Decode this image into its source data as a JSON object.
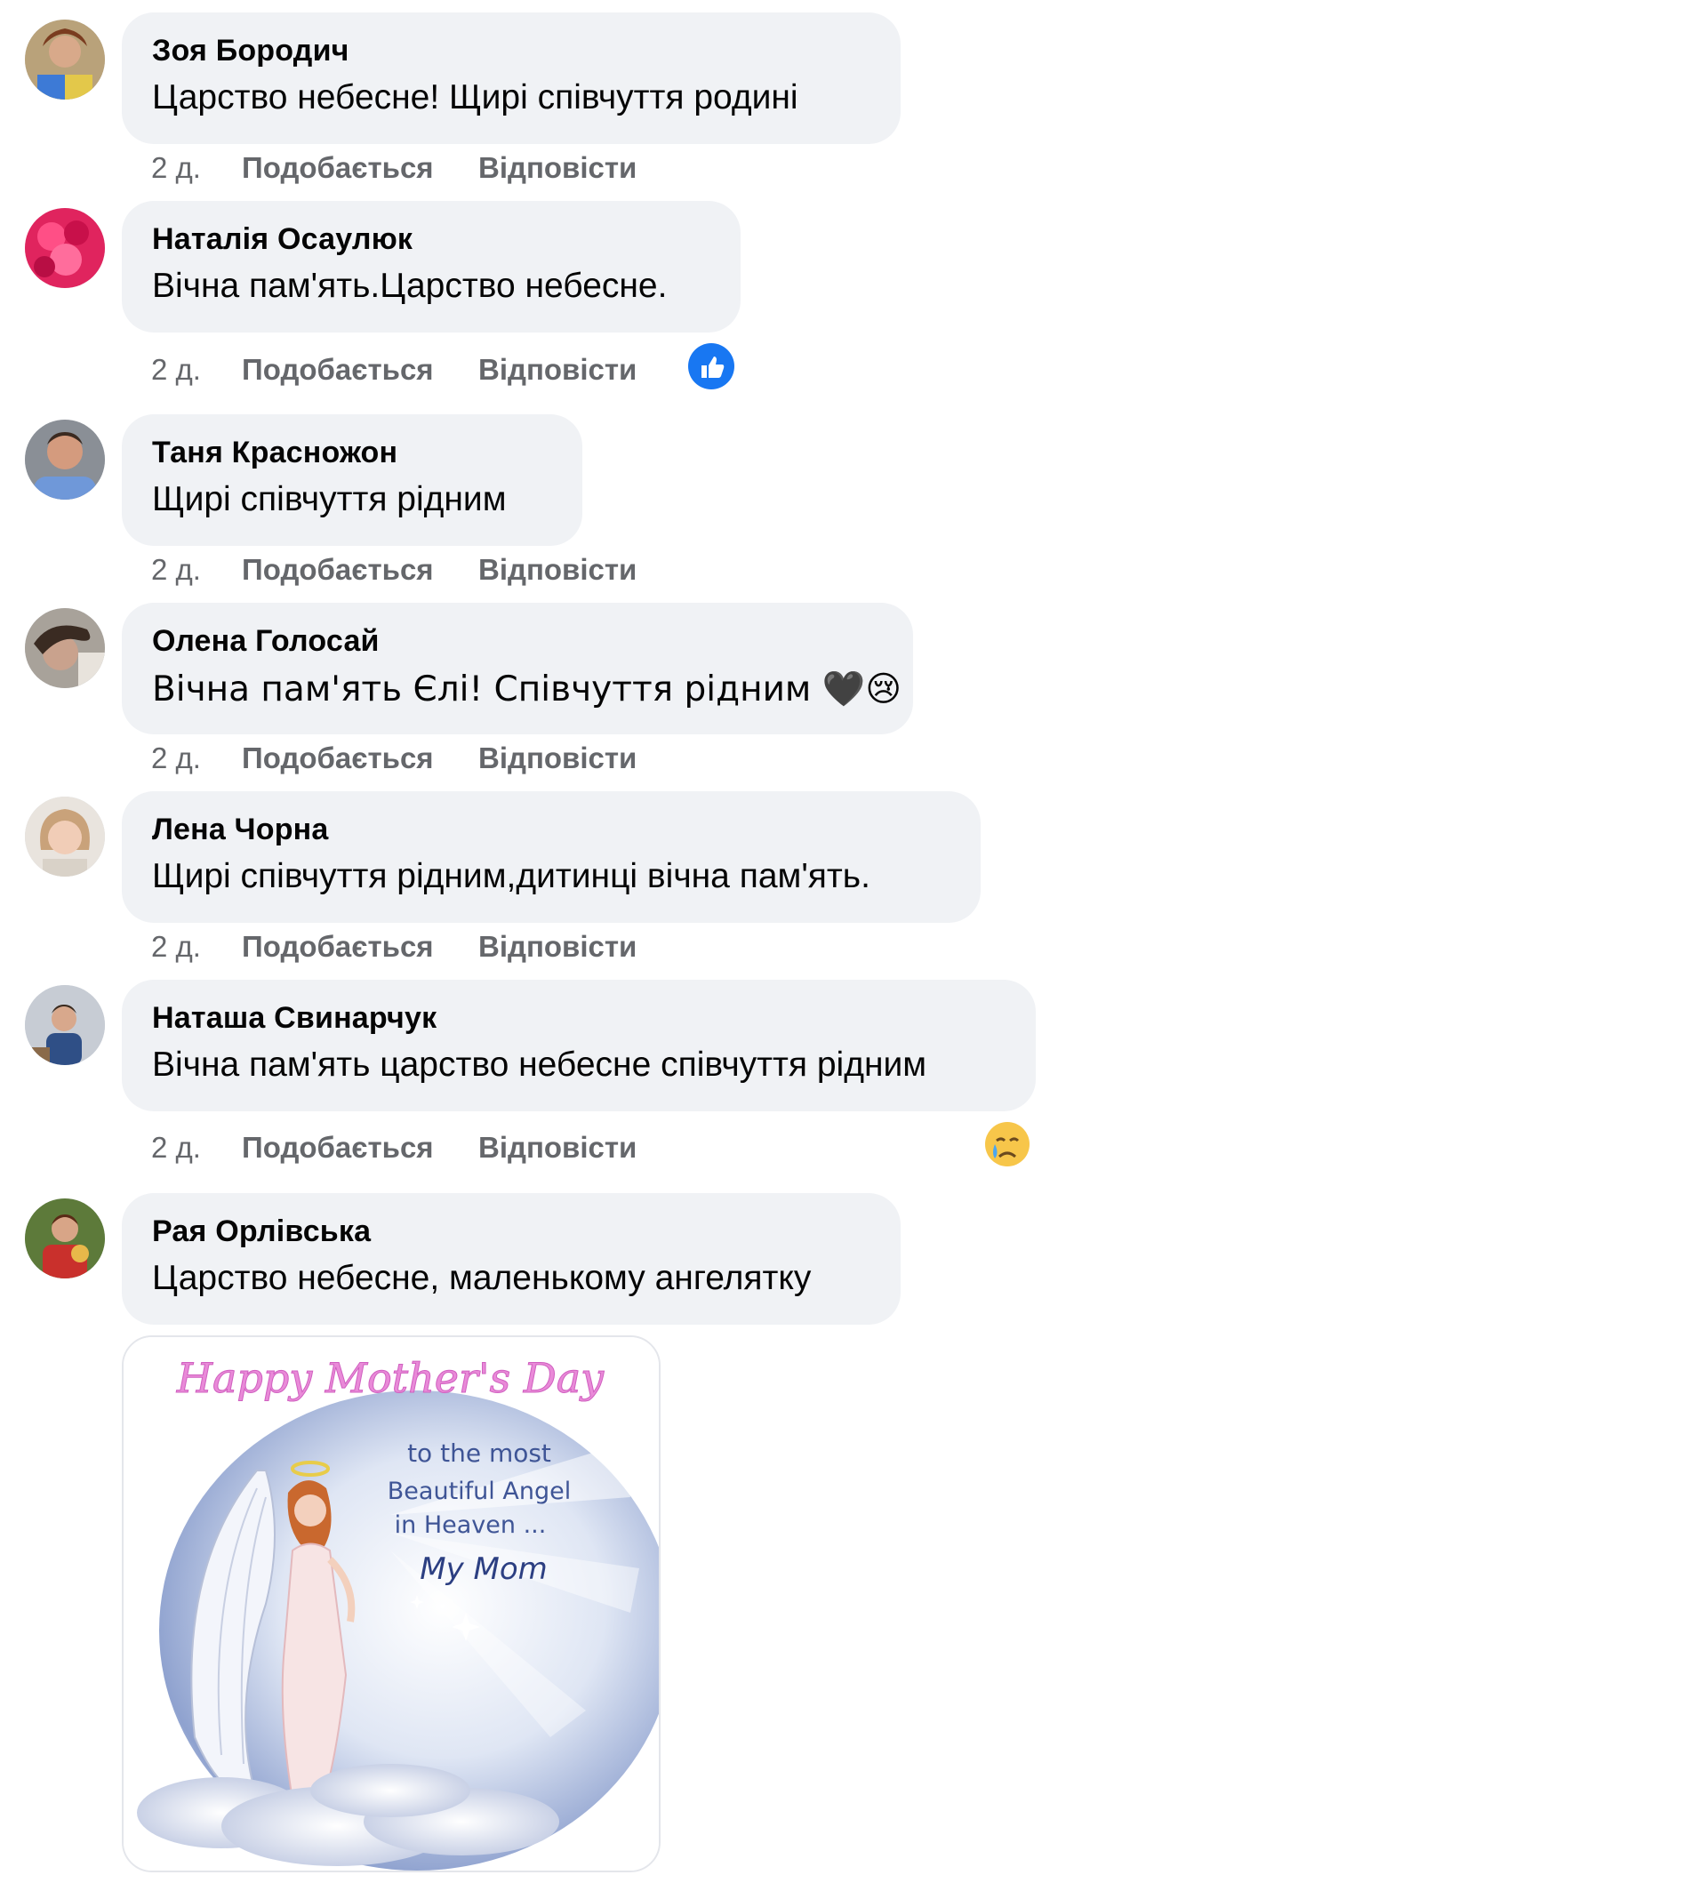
{
  "colors": {
    "bubble": "#f0f2f5",
    "text": "#050505",
    "meta": "#65676b",
    "like_blue": "#1877f2"
  },
  "comments": [
    {
      "author": "Зоя Бородич",
      "text": "Царство небесне! Щирі співчуття родині",
      "time": "2 д.",
      "like": "Подобається",
      "reply": "Відповісти"
    },
    {
      "author": "Наталія Осаулюк",
      "text": "Вічна пам'ять.Царство небесне.",
      "time": "2 д.",
      "like": "Подобається",
      "reply": "Відповісти",
      "reaction": "like-icon"
    },
    {
      "author": "Таня Красножон",
      "text": "Щирі співчуття рідним",
      "time": "2 д.",
      "like": "Подобається",
      "reply": "Відповісти"
    },
    {
      "author": "Олена Голосай",
      "text": "Вічна пам'ять Єлі! Співчуття рідним 🖤😢",
      "time": "2 д.",
      "like": "Подобається",
      "reply": "Відповісти"
    },
    {
      "author": "Лена Чорна",
      "text": "Щирі співчуття рідним,дитинці вічна пам'ять.",
      "time": "2 д.",
      "like": "Подобається",
      "reply": "Відповісти"
    },
    {
      "author": "Наташа Свинарчук",
      "text": "Вічна пам'ять царство небесне співчуття рідним",
      "time": "2 д.",
      "like": "Подобається",
      "reply": "Відповісти",
      "reaction": "crying-face-icon"
    },
    {
      "author": "Рая Орлівська",
      "text": "Царство небесне, маленькому ангелятку"
    }
  ],
  "attachment": {
    "title": "Happy Mother's Day",
    "line1": "to the most",
    "line2": "Beautiful Angel",
    "line3": "in Heaven ...",
    "line4": "My Mom"
  }
}
